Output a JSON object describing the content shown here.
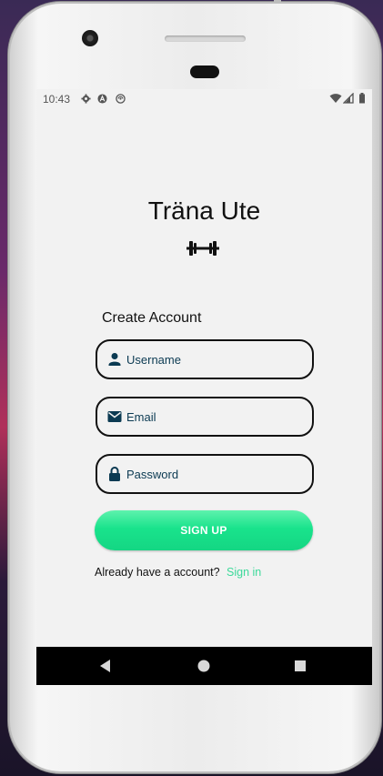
{
  "statusbar": {
    "time": "10:43",
    "left_icons": [
      "gear-icon",
      "android-studio-icon",
      "sync-icon"
    ],
    "right_icons": [
      "wifi-icon",
      "signal-icon",
      "battery-icon"
    ]
  },
  "app": {
    "title": "Träna Ute",
    "logo_icon": "dumbbell-icon",
    "form_heading": "Create Account",
    "fields": {
      "username": {
        "placeholder": "Username",
        "value": "",
        "icon": "person-icon"
      },
      "email": {
        "placeholder": "Email",
        "value": "",
        "icon": "mail-icon"
      },
      "password": {
        "placeholder": "Password",
        "value": "",
        "icon": "lock-icon"
      }
    },
    "signup_label": "SIGN UP",
    "signin_prompt": "Already have a account?",
    "signin_link": "Sign in"
  },
  "navbar": {
    "buttons": [
      "back-icon",
      "home-icon",
      "recents-icon"
    ]
  },
  "colors": {
    "accent_green": "#19e38c",
    "link_green": "#3cd99a",
    "field_text": "#0b3a52",
    "screen_bg": "#f2f2f2"
  }
}
